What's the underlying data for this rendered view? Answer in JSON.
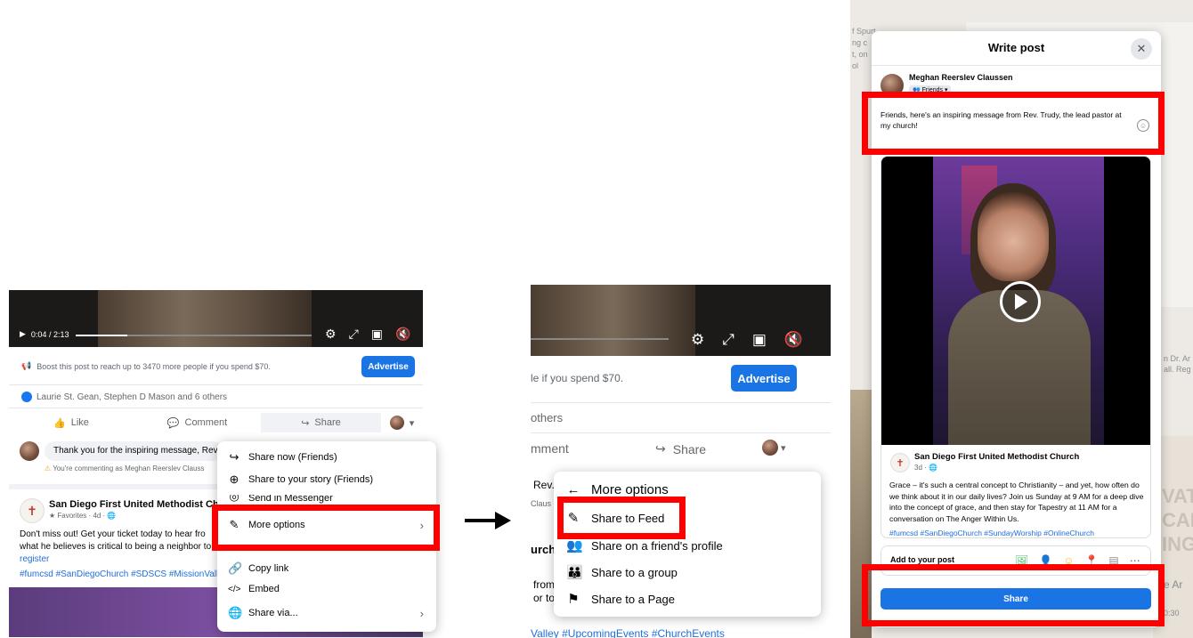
{
  "panel1": {
    "video": {
      "time": "0:04 / 2:13",
      "progress": 0.22
    },
    "boost_text": "Boost this post to reach up to 3470 more people if you spend $70.",
    "advertise_label": "Advertise",
    "reactions_text": "Laurie St. Gean, Stephen D Mason and 6 others",
    "actions": {
      "like": "Like",
      "comment": "Comment",
      "share": "Share"
    },
    "comment_text": "Thank you for the inspiring message, Rev.",
    "commenting_as": "You're commenting as Meghan Reerslev Clauss",
    "post": {
      "page_name": "San Diego First United Methodist Church",
      "meta": "★ Favorites · 4d · 🌐",
      "text_line1": "Don't miss out! Get your ticket today to hear fro",
      "text_line2": "what he believes is critical to being a neighbor to",
      "link": "register",
      "tags": "#fumcsd #SanDiegoChurch #SDSCS #MissionValle"
    },
    "share_menu": {
      "items": [
        {
          "label": "Share now (Friends)",
          "icon": "share-arrow-icon"
        },
        {
          "label": "Share to your story (Friends)",
          "icon": "plus-circle-icon"
        },
        {
          "label": "Send in Messenger",
          "icon": "messenger-icon"
        },
        {
          "label": "More options",
          "icon": "edit-square-icon"
        },
        {
          "label": "Copy link",
          "icon": "link-icon"
        },
        {
          "label": "Embed",
          "icon": "code-icon"
        },
        {
          "label": "Share via...",
          "icon": "globe-icon"
        }
      ]
    }
  },
  "panel2": {
    "boost_text": "le if you spend $70.",
    "advertise_label": "Advertise",
    "others_text": "others",
    "comment_label": "mment",
    "share_label": "Share",
    "rev_text": "Rev.",
    "claus_text": "Claus",
    "urch_text": "urch",
    "from_line1": "from",
    "from_line2": "or to",
    "tags": "Valley #UpcomingEvents #ChurchEvents",
    "menu": {
      "header": "More options",
      "items": [
        {
          "label": "Share to Feed",
          "icon": "edit-square-icon"
        },
        {
          "label": "Share on a friend's profile",
          "icon": "friends-icon"
        },
        {
          "label": "Share to a group",
          "icon": "group-icon"
        },
        {
          "label": "Share to a Page",
          "icon": "flag-icon"
        }
      ]
    }
  },
  "panel3": {
    "title": "Write post",
    "user_name": "Meghan Reerslev Claussen",
    "audience": "👥 Friends ▾",
    "message": "Friends, here's an inspiring message from Rev. Trudy, the lead pastor at my church!",
    "card": {
      "page_name": "San Diego First United Methodist Church",
      "meta": "3d · 🌐",
      "text": "Grace – it's such a central concept to Christianity – and yet, how often do we think about it in our daily lives? Join us Sunday at 9 AM for a deep dive into the concept of grace, and then stay for Tapestry at 11 AM for a conversation on The Anger Within Us.",
      "tags": "#fumcsd #SanDiegoChurch #SundayWorship #OnlineChurch"
    },
    "add_to_post": "Add to your post",
    "share_label": "Share",
    "side_texts": [
      "f Spurt",
      "ng c",
      "t, on",
      "ol",
      "VAT",
      "CAL",
      "ING",
      "n Dr. Ar",
      "all. Reg",
      "e Ar",
      "0:30"
    ]
  },
  "colors": {
    "accent": "#1b74e4",
    "highlight": "#ff0000"
  }
}
